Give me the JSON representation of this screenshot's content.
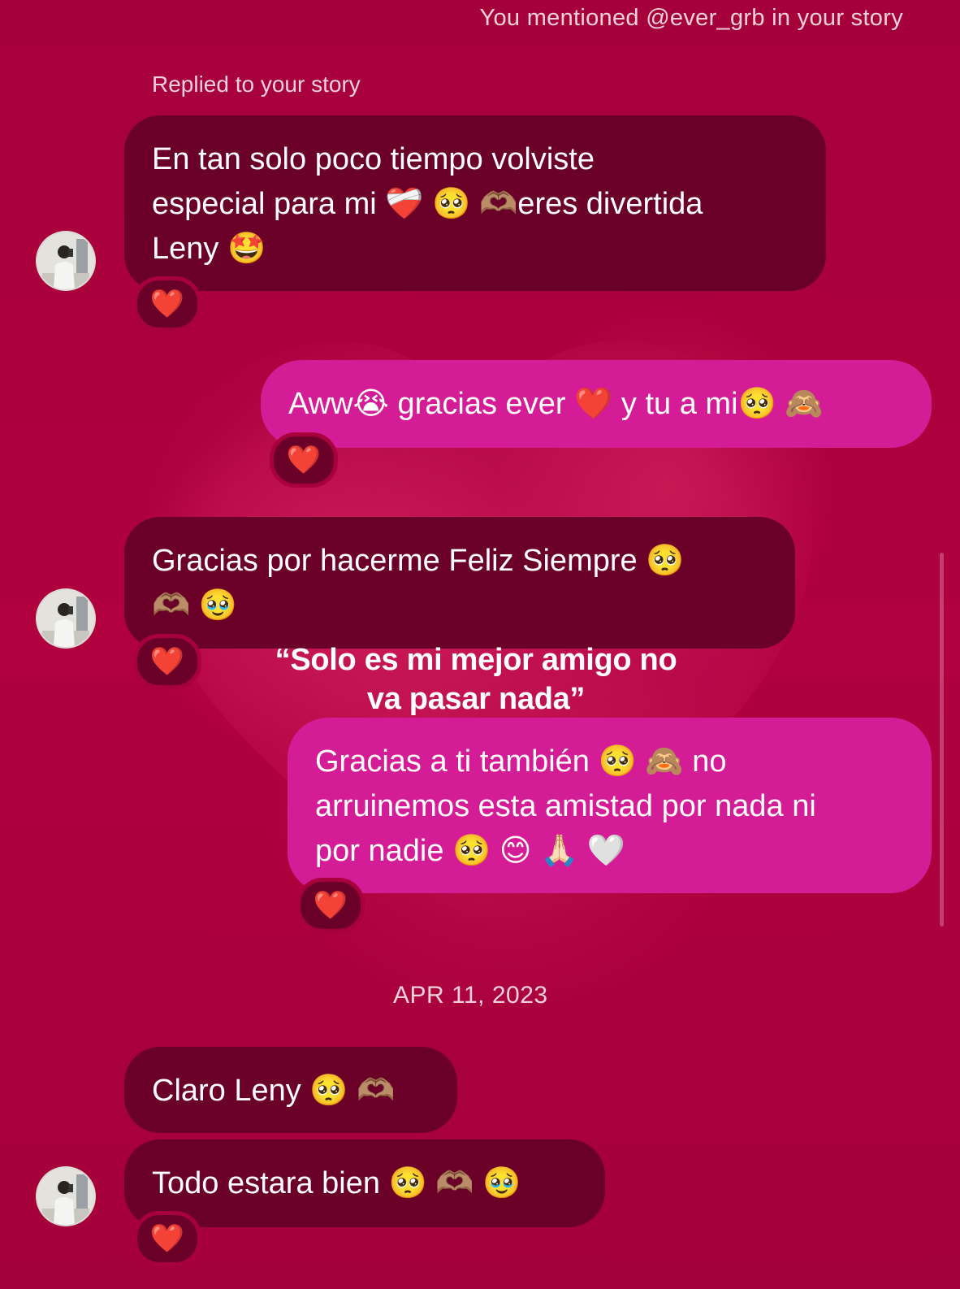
{
  "header": {
    "mention_notice": "You mentioned @ever_grb in your story"
  },
  "thread": {
    "story_reply_label": "Replied to your story",
    "date_separator": "APR 11, 2023",
    "messages": [
      {
        "sender": "them",
        "lines": [
          "En tan solo poco tiempo volviste",
          "especial para mi ❤️‍🩹 🥺 🫶🏽eres divertida",
          "Leny 🤩"
        ],
        "reaction": "❤️"
      },
      {
        "sender": "me",
        "lines": [
          "Aww😭 gracias ever ❤️ y tu a mi🥺 🙈"
        ],
        "reaction": "❤️"
      },
      {
        "sender": "them",
        "lines": [
          "Gracias por hacerme Feliz Siempre 🥺",
          "🫶🏽 🥹"
        ],
        "reaction": "❤️"
      },
      {
        "sender": "me",
        "lines": [
          "Gracias a ti también 🥺 🙈  no",
          "arruinemos esta amistad por nada ni",
          "por nadie 🥺 😊 🙏🏻 🤍"
        ],
        "reaction": "❤️"
      },
      {
        "sender": "them",
        "lines": [
          "Claro Leny 🥺 🫶🏽"
        ]
      },
      {
        "sender": "them",
        "lines": [
          "Todo estara bien 🥺 🫶🏽 🥹"
        ],
        "reaction": "❤️"
      }
    ]
  },
  "overlay_caption": {
    "line1": "“Solo es mi mejor amigo no",
    "line2": "va pasar nada”"
  },
  "colors": {
    "background": "#a8003c",
    "incoming_bubble": "#6a0028",
    "outgoing_bubble": "#d41c96",
    "text": "#ffffff"
  }
}
